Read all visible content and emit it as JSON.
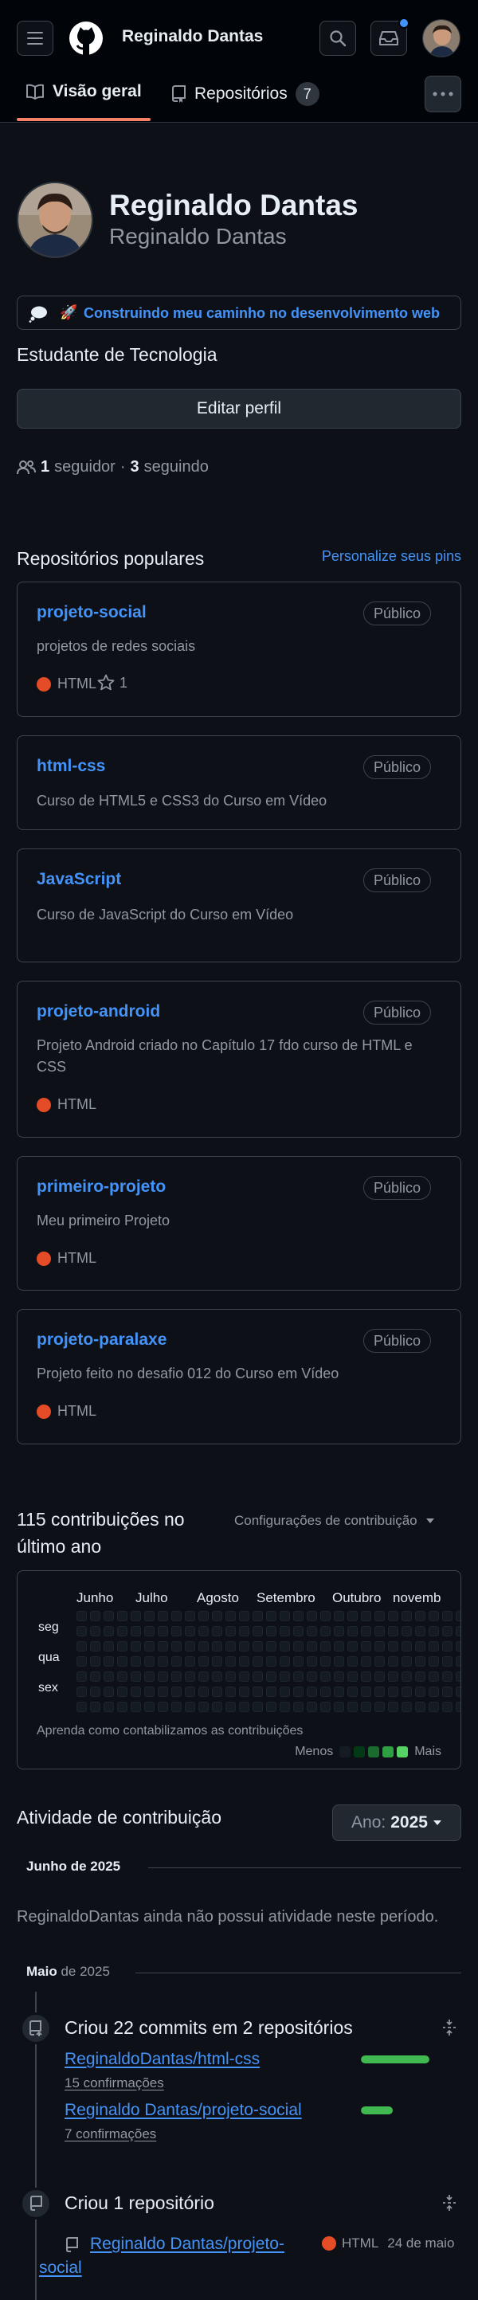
{
  "header": {
    "username": "Reginaldo Dantas",
    "tabs": [
      {
        "label": "Visão geral"
      },
      {
        "label": "Repositórios",
        "count": "7"
      }
    ]
  },
  "profile": {
    "name": "Reginaldo Dantas",
    "login": "Reginaldo Dantas",
    "status_emoji": "🚀",
    "status_text": "Construindo meu caminho no desenvolvimento web",
    "bio": "Estudante de Tecnologia",
    "edit_button": "Editar perfil",
    "followers_count": "1",
    "followers_label": "seguidor",
    "following_count": "3",
    "following_label": "seguindo",
    "separator": "·"
  },
  "pinned": {
    "title": "Repositórios populares",
    "customize": "Personalize seus pins",
    "repos": [
      {
        "name": "projeto-social",
        "visibility": "Público",
        "description": "projetos de redes sociais",
        "language": "HTML",
        "stars": "1"
      },
      {
        "name": "html-css",
        "visibility": "Público",
        "description": "Curso de HTML5 e CSS3 do Curso em Vídeo"
      },
      {
        "name": "JavaScript",
        "visibility": "Público",
        "description": "Curso de JavaScript do Curso em Vídeo"
      },
      {
        "name": "projeto-android",
        "visibility": "Público",
        "description": "Projeto Android criado no Capítulo 17 fdo curso de HTML e CSS",
        "language": "HTML"
      },
      {
        "name": "primeiro-projeto",
        "visibility": "Público",
        "description": "Meu primeiro Projeto",
        "language": "HTML"
      },
      {
        "name": "projeto-paralaxe",
        "visibility": "Público",
        "description": "Projeto feito no desafio 012 do Curso em Vídeo",
        "language": "HTML"
      }
    ]
  },
  "contributions": {
    "title_line1": "115 contribuições no",
    "title_line2": "último ano",
    "settings": "Configurações de contribuição",
    "months": [
      "Junho",
      "Julho",
      "Agosto",
      "Setembro",
      "Outubro",
      "novemb"
    ],
    "days": [
      "seg",
      "qua",
      "sex"
    ],
    "learn": "Aprenda como contabilizamos as contribuições",
    "less": "Menos",
    "more": "Mais",
    "colors": [
      "#151b23",
      "#033a16",
      "#196c2e",
      "#2ea043",
      "#56d364"
    ]
  },
  "activity": {
    "title": "Atividade de contribuição",
    "year_label": "Ano:",
    "year_value": "2025",
    "month1_bold": "Junho",
    "month1_rest": "de 2025",
    "empty_text": "ReginaldoDantas ainda não possui atividade neste período.",
    "month2_bold": "Maio",
    "month2_rest": "de 2025",
    "commits_title": "Criou 22 commits em 2 repositórios",
    "commit_repos": [
      {
        "name": "ReginaldoDantas/html-css",
        "count": "15 confirmações",
        "fraction": 0.68
      },
      {
        "name": "Reginaldo Dantas/projeto-social",
        "count": "7 confirmações",
        "fraction": 0.32
      }
    ],
    "created_title": "Criou 1 repositório",
    "created_repo_line1": "Reginaldo Dantas/projeto-",
    "created_repo_line2": "social",
    "created_lang": "HTML",
    "created_date": "24 de maio"
  }
}
